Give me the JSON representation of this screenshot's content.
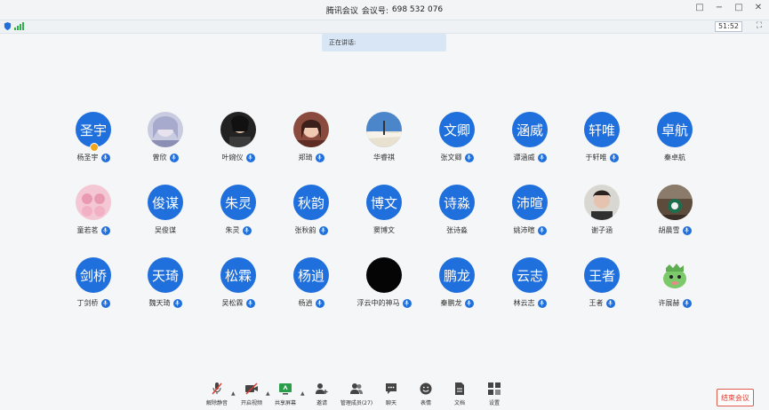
{
  "window": {
    "app_name": "腾讯会议",
    "meeting_id_label": "会议号:",
    "meeting_id": "698 532 076",
    "controls": [
      "restore-icon",
      "minimize-icon",
      "maximize-icon",
      "close-icon"
    ]
  },
  "status": {
    "timer": "51:52",
    "signal_color": "#2bb34a"
  },
  "speaking_banner": "正在讲话:",
  "colors": {
    "accent": "#1f6fdc",
    "host_badge": "#f3a519",
    "end": "#e0392b"
  },
  "participants": [
    {
      "name": "杨圣宇",
      "avatar_text": "圣宇",
      "type": "text",
      "host": true
    },
    {
      "name": "曾欣",
      "type": "pic",
      "pic": "anime"
    },
    {
      "name": "叶婉仪",
      "type": "pic",
      "pic": "dark"
    },
    {
      "name": "郑琦",
      "type": "pic",
      "pic": "girl"
    },
    {
      "name": "华睿祺",
      "type": "pic",
      "pic": "sky",
      "no_mic": true
    },
    {
      "name": "张文卿",
      "avatar_text": "文卿",
      "type": "text"
    },
    {
      "name": "谭涵威",
      "avatar_text": "涵威",
      "type": "text"
    },
    {
      "name": "于轩唯",
      "avatar_text": "轩唯",
      "type": "text"
    },
    {
      "name": "秦卓航",
      "avatar_text": "卓航",
      "type": "text",
      "no_mic": true
    },
    {
      "name": "童若茗",
      "type": "pic",
      "pic": "pink"
    },
    {
      "name": "吴俊谋",
      "avatar_text": "俊谋",
      "type": "text",
      "no_mic": true
    },
    {
      "name": "朱灵",
      "avatar_text": "朱灵",
      "type": "text"
    },
    {
      "name": "张秋韵",
      "avatar_text": "秋韵",
      "type": "text"
    },
    {
      "name": "窦博文",
      "avatar_text": "博文",
      "type": "text",
      "no_mic": true
    },
    {
      "name": "张诗淼",
      "avatar_text": "诗淼",
      "type": "text",
      "no_mic": true
    },
    {
      "name": "姚沛暄",
      "avatar_text": "沛暄",
      "type": "text"
    },
    {
      "name": "谢子涵",
      "type": "pic",
      "pic": "boy",
      "no_mic": true
    },
    {
      "name": "胡晨雪",
      "type": "pic",
      "pic": "cafe"
    },
    {
      "name": "丁剑桥",
      "avatar_text": "剑桥",
      "type": "text"
    },
    {
      "name": "魏天琦",
      "avatar_text": "天琦",
      "type": "text"
    },
    {
      "name": "吴松霖",
      "avatar_text": "松霖",
      "type": "text"
    },
    {
      "name": "杨逍",
      "avatar_text": "杨逍",
      "type": "text"
    },
    {
      "name": "浮云中的神马",
      "type": "pic",
      "pic": "black"
    },
    {
      "name": "秦鹏龙",
      "avatar_text": "鹏龙",
      "type": "text"
    },
    {
      "name": "林云志",
      "avatar_text": "云志",
      "type": "text"
    },
    {
      "name": "王者",
      "avatar_text": "王者",
      "type": "text"
    },
    {
      "name": "许展赫",
      "type": "pic",
      "pic": "dino"
    }
  ],
  "toolbar": {
    "mute_label": "解除静音",
    "video_label": "开启视频",
    "share_label": "共享屏幕",
    "invite_label": "邀请",
    "members_label": "管理成员(27)",
    "chat_label": "聊天",
    "reaction_label": "表情",
    "docs_label": "文档",
    "settings_label": "设置",
    "end_label": "结束会议"
  }
}
